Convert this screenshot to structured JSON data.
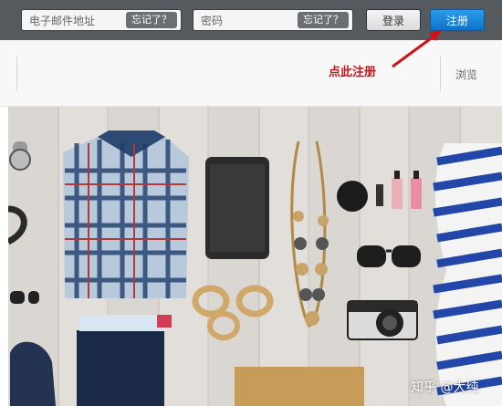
{
  "login": {
    "email_placeholder": "电子邮件地址",
    "password_placeholder": "密码",
    "forgot_label": "忘记了？",
    "login_button": "登录",
    "register_button": "注册"
  },
  "subbar": {
    "hint": "点此注册",
    "browse": "浏览"
  },
  "watermark": "知乎 @大纯",
  "colors": {
    "topbar": "#555a5f",
    "accent": "#1a86d8",
    "hint": "#c7141d"
  }
}
